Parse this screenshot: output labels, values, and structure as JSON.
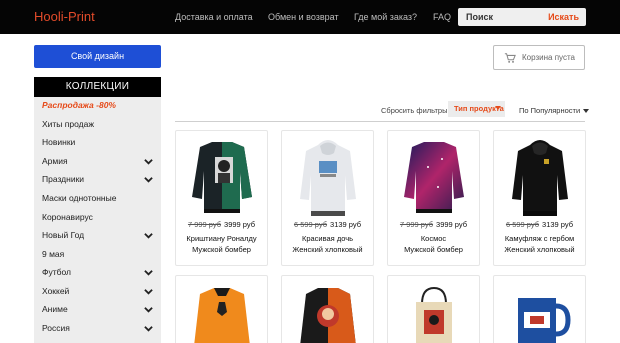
{
  "header": {
    "logo": "Hooli-Print",
    "nav": [
      "Доставка и оплата",
      "Обмен и возврат",
      "Где мой заказ?",
      "FAQ"
    ],
    "search": {
      "placeholder": "Поиск",
      "button": "Искать"
    }
  },
  "sidebar": {
    "design_button": "Свой дизайн",
    "collections_title": "КОЛЛЕКЦИИ",
    "items": [
      {
        "label": "Распродажа -80%",
        "chevron": false
      },
      {
        "label": "Хиты продаж",
        "chevron": false
      },
      {
        "label": "Новинки",
        "chevron": false
      },
      {
        "label": "Армия",
        "chevron": true
      },
      {
        "label": "Праздники",
        "chevron": true
      },
      {
        "label": "Маски однотонные",
        "chevron": false
      },
      {
        "label": "Коронавирус",
        "chevron": false
      },
      {
        "label": "Новый Год",
        "chevron": true
      },
      {
        "label": "9 мая",
        "chevron": false
      },
      {
        "label": "Футбол",
        "chevron": true
      },
      {
        "label": "Хоккей",
        "chevron": true
      },
      {
        "label": "Аниме",
        "chevron": true
      },
      {
        "label": "Россия",
        "chevron": true
      }
    ]
  },
  "cart": {
    "label": "Корзина пуста"
  },
  "filters": {
    "reset": "Сбросить фильтры",
    "product_type": "Тип продукта",
    "sort": "По Популярности"
  },
  "products": [
    {
      "old_price": "7 999 руб",
      "price": "3999 руб",
      "name": "Криштиану Роналду",
      "kind": "Мужской бомбер"
    },
    {
      "old_price": "6 599 руб",
      "price": "3139 руб",
      "name": "Красивая дочь",
      "kind": "Женский хлопковый"
    },
    {
      "old_price": "7 999 руб",
      "price": "3999 руб",
      "name": "Космос",
      "kind": "Мужской бомбер"
    },
    {
      "old_price": "6 599 руб",
      "price": "3139 руб",
      "name": "Камуфляж с гербом",
      "kind": "Женский хлопковый"
    }
  ],
  "colors": {
    "accent": "#e64a19",
    "primary_button": "#1e4fd6",
    "header_bg": "#050505",
    "sidebar_bg": "#ededed"
  }
}
